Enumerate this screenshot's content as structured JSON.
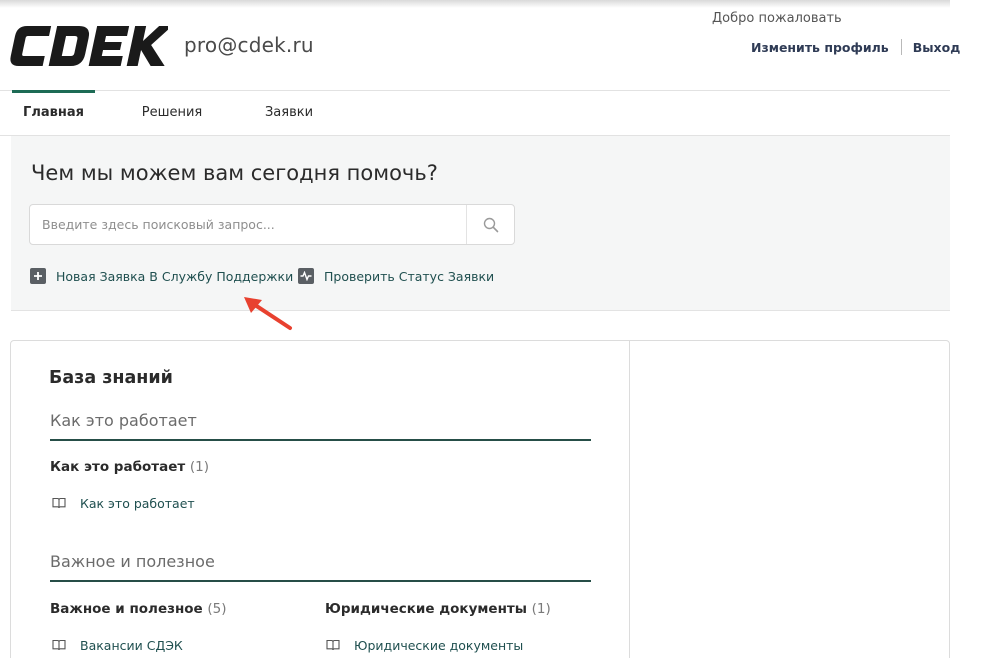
{
  "header": {
    "brand": "CDEK",
    "user_email": "pro@cdek.ru",
    "welcome_text": "Добро пожаловать",
    "edit_profile_label": "Изменить профиль",
    "logout_label": "Выход"
  },
  "nav": {
    "tabs": [
      {
        "label": "Главная",
        "active": true
      },
      {
        "label": "Решения",
        "active": false
      },
      {
        "label": "Заявки",
        "active": false
      }
    ]
  },
  "help": {
    "title": "Чем мы можем вам сегодня помочь?",
    "search_placeholder": "Введите здесь поисковый запрос...",
    "search_icon": "search-icon",
    "new_ticket_label": "Новая Заявка В Службу Поддержки",
    "new_ticket_icon": "plus-square-icon",
    "check_status_label": "Проверить Статус Заявки",
    "check_status_icon": "activity-square-icon",
    "annotation": "red-arrow"
  },
  "knowledge_base": {
    "title": "База знаний",
    "sections": [
      {
        "heading": "Как это работает",
        "categories": [
          {
            "title": "Как это работает",
            "count": "(1)",
            "articles": [
              "Как это работает"
            ]
          }
        ]
      },
      {
        "heading": "Важное и полезное",
        "categories": [
          {
            "title": "Важное и полезное",
            "count": "(5)",
            "articles": [
              "Вакансии СДЭК"
            ]
          },
          {
            "title": "Юридические документы",
            "count": "(1)",
            "articles": [
              "Юридические документы"
            ]
          }
        ]
      }
    ],
    "article_icon": "book-icon"
  },
  "colors": {
    "brand_dark": "#1a1a1a",
    "accent_green": "#1d6b55",
    "link_color": "#1f4f4f",
    "panel_bg": "#f5f6f6",
    "arrow_red": "#e8412f"
  }
}
